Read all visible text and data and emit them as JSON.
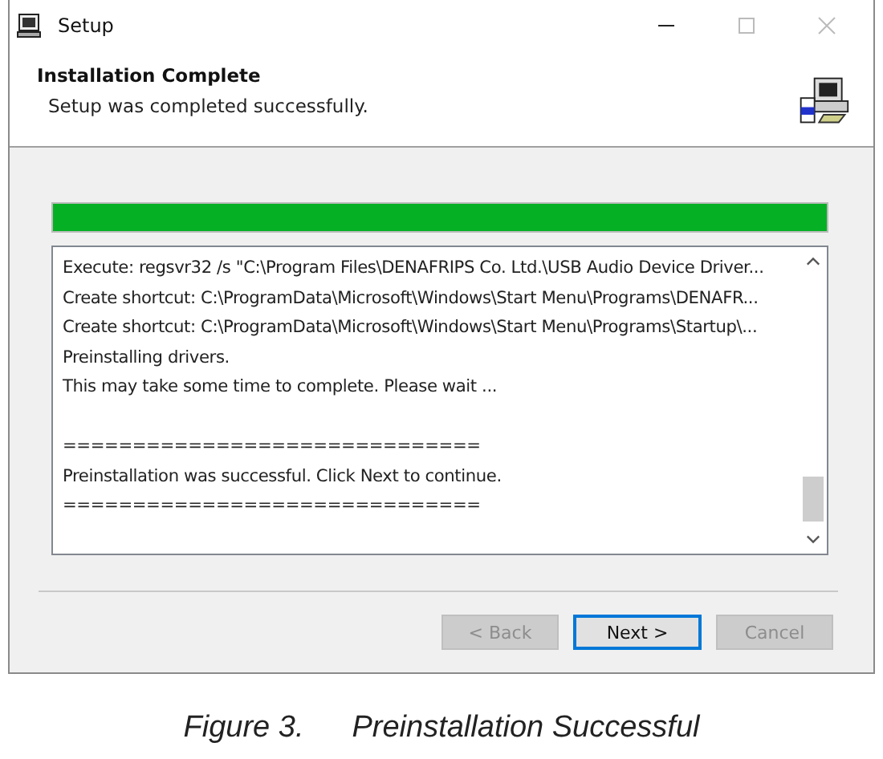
{
  "window": {
    "title": "Setup"
  },
  "header": {
    "title": "Installation Complete",
    "subtitle": "Setup was completed successfully."
  },
  "progress": {
    "level": 1.0
  },
  "log": {
    "lines": [
      "Execute: regsvr32 /s \"C:\\Program Files\\DENAFRIPS Co. Ltd.\\USB Audio Device Driver...",
      "Create shortcut: C:\\ProgramData\\Microsoft\\Windows\\Start Menu\\Programs\\DENAFR...",
      "Create shortcut: C:\\ProgramData\\Microsoft\\Windows\\Start Menu\\Programs\\Startup\\...",
      "Preinstalling drivers.",
      "This may take some time to complete. Please wait ..."
    ],
    "result_lines": [
      "==============================",
      "Preinstallation was successful. Click Next to continue.",
      "=============================="
    ]
  },
  "buttons": [
    {
      "label": "< Back",
      "disabled": true,
      "focused": false
    },
    {
      "label": "Next >",
      "disabled": false,
      "focused": true
    },
    {
      "label": "Cancel",
      "disabled": true,
      "focused": false
    }
  ],
  "caption": {
    "number": "Figure 3.",
    "text": "Preinstallation Successful"
  }
}
